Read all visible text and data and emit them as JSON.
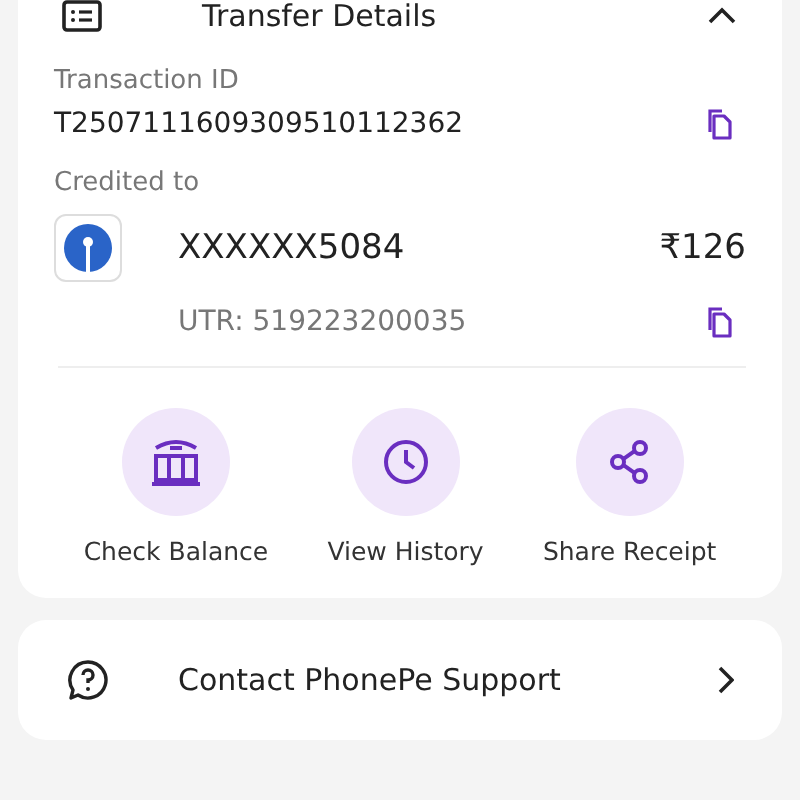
{
  "section": {
    "title": "Transfer Details",
    "expanded": true
  },
  "transaction": {
    "label": "Transaction ID",
    "value": "T2507111609309510112362"
  },
  "credited": {
    "label": "Credited to",
    "account": "XXXXXX5084",
    "amount": "₹126",
    "utr": "UTR: 519223200035"
  },
  "actions": [
    {
      "kind": "bank",
      "label": "Check Balance"
    },
    {
      "kind": "clock",
      "label": "View History"
    },
    {
      "kind": "share",
      "label": "Share Receipt"
    }
  ],
  "support": {
    "label": "Contact PhonePe Support"
  }
}
